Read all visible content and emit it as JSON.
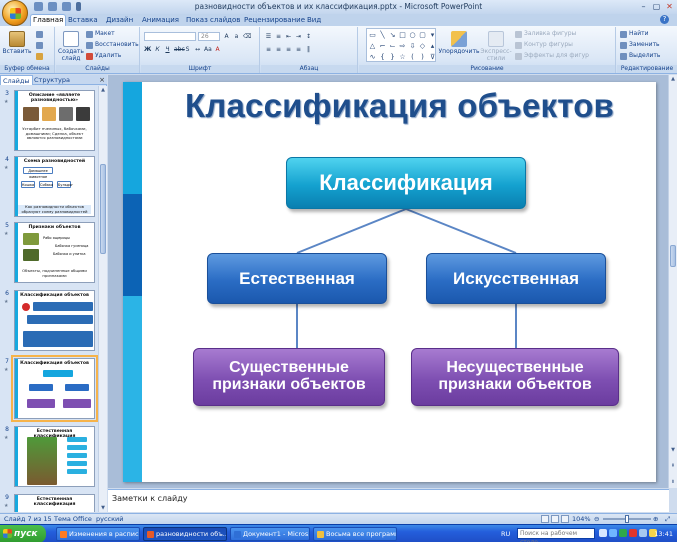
{
  "window": {
    "title": "разновидности объектов и их классификация.pptx - Microsoft PowerPoint",
    "help_icon": "?"
  },
  "ribbon": {
    "tabs": [
      "Главная",
      "Вставка",
      "Дизайн",
      "Анимация",
      "Показ слайдов",
      "Рецензирование",
      "Вид"
    ],
    "active_tab": "Главная",
    "clipboard": {
      "paste": "Вставить",
      "group": "Буфер обмена"
    },
    "slides": {
      "new_slide": "Создать слайд",
      "layout": "Макет",
      "reset": "Восстановить",
      "delete": "Удалить",
      "group": "Слайды"
    },
    "font": {
      "size_value": "26",
      "group": "Шрифт"
    },
    "paragraph": {
      "group": "Абзац"
    },
    "drawing": {
      "arrange": "Упорядочить",
      "quick_styles": "Экспресс-стили",
      "fill": "Заливка фигуры",
      "outline": "Контур фигуры",
      "effects": "Эффекты для фигур",
      "group": "Рисование"
    },
    "editing": {
      "find": "Найти",
      "replace": "Заменить",
      "select": "Выделить",
      "group": "Редактирование"
    }
  },
  "left_pane": {
    "tabs": [
      "Слайды",
      "Структура"
    ],
    "close": "×",
    "thumbnails": [
      {
        "num": "3",
        "title": "Описание «являете разновидностью»",
        "caption": "Устарбит пчелиных, бабочками, домашними; Сделка, объект являются разновидностями"
      },
      {
        "num": "4",
        "title": "Схема разновидностей",
        "labels": [
          "Домашнее животное",
          "Кошка",
          "Собака",
          "Бульдог"
        ],
        "caption": "Как разновидности объектов образуют схему разновидностей"
      },
      {
        "num": "5",
        "title": "Признаки объектов",
        "labels": [
          "Рабо ящерицы",
          "Бабочка гусеница",
          "Бабочка и улитка"
        ],
        "caption": "Объекты, подчиненные общими признаками"
      },
      {
        "num": "6",
        "title": "Классификация объектов",
        "caption": ""
      },
      {
        "num": "7",
        "title": "Классификация объектов",
        "caption": ""
      },
      {
        "num": "8",
        "title": "Естественная классификация",
        "caption": ""
      },
      {
        "num": "9",
        "title": "Естественная классификация",
        "caption": ""
      }
    ],
    "selected": "7"
  },
  "slide": {
    "title": "Классификация объектов",
    "root": "Классификация",
    "left_branch": "Естественная",
    "right_branch": "Искусственная",
    "left_leaf": "Существенные признаки объектов",
    "right_leaf": "Несущественные признаки объектов"
  },
  "notes": {
    "placeholder": "Заметки к слайду"
  },
  "status": {
    "slide_info": "Слайд 7 из 15",
    "theme": "Тема Office",
    "language": "русский",
    "zoom": "104%"
  },
  "taskbar": {
    "start": "пуск",
    "tasks": [
      "Изменения в распис...",
      "разновидности объ...",
      "Документ1 - Micros...",
      "Восьма все программы"
    ],
    "lang": "RU",
    "search_placeholder": "Поиск на рабочем столе",
    "clock": "13:41"
  },
  "colors": {
    "accent_cyan": "#15a6de",
    "title_blue": "#1f4e8c",
    "node_blue": "#2a6cc4",
    "node_purple": "#7e4fb2",
    "connector": "#5b86c5"
  }
}
